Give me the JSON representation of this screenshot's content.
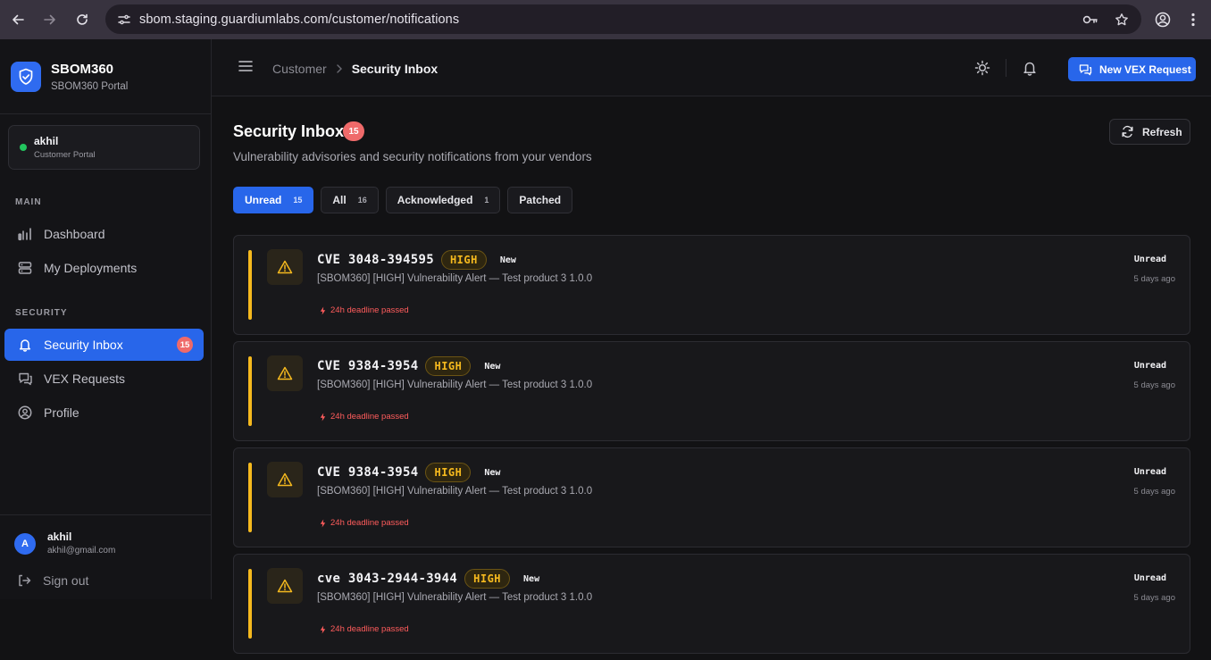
{
  "browser": {
    "url": "sbom.staging.guardiumlabs.com/customer/notifications"
  },
  "brand": {
    "name": "SBOM360",
    "subtitle": "SBOM360 Portal"
  },
  "user_card": {
    "name": "akhil",
    "role": "Customer Portal"
  },
  "sidebar": {
    "sections": [
      {
        "title": "MAIN"
      },
      {
        "title": "SECURITY"
      }
    ],
    "items": [
      {
        "label": "Dashboard",
        "icon": "bar-chart-icon"
      },
      {
        "label": "My Deployments",
        "icon": "server-icon"
      },
      {
        "label": "Security Inbox",
        "icon": "bell-icon",
        "badge": "15",
        "active": true
      },
      {
        "label": "VEX Requests",
        "icon": "chat-icon"
      },
      {
        "label": "Profile",
        "icon": "user-circle-icon"
      }
    ]
  },
  "footer": {
    "avatar_initial": "A",
    "name": "akhil",
    "email": "akhil@gmail.com",
    "signout": "Sign out"
  },
  "topbar": {
    "breadcrumb_parent": "Customer",
    "breadcrumb_current": "Security Inbox",
    "new_vex_label": "New VEX Request"
  },
  "page": {
    "title": "Security Inbox",
    "count": "15",
    "subtitle": "Vulnerability advisories and security notifications from your vendors",
    "refresh_label": "Refresh"
  },
  "tabs": [
    {
      "label": "Unread",
      "count": "15",
      "active": true
    },
    {
      "label": "All",
      "count": "16"
    },
    {
      "label": "Acknowledged",
      "count": "1"
    },
    {
      "label": "Patched",
      "count": ""
    }
  ],
  "notifications": [
    {
      "cve": "CVE 3048-394595",
      "severity": "HIGH",
      "tag": "New",
      "subject": "[SBOM360] [HIGH] Vulnerability Alert — Test product 3 1.0.0",
      "deadline": "24h deadline passed",
      "status": "Unread",
      "time": "5 days ago"
    },
    {
      "cve": "CVE 9384-3954",
      "severity": "HIGH",
      "tag": "New",
      "subject": "[SBOM360] [HIGH] Vulnerability Alert — Test product 3 1.0.0",
      "deadline": "24h deadline passed",
      "status": "Unread",
      "time": "5 days ago"
    },
    {
      "cve": "CVE 9384-3954",
      "severity": "HIGH",
      "tag": "New",
      "subject": "[SBOM360] [HIGH] Vulnerability Alert — Test product 3 1.0.0",
      "deadline": "24h deadline passed",
      "status": "Unread",
      "time": "5 days ago"
    },
    {
      "cve": "cve 3043-2944-3944",
      "severity": "HIGH",
      "tag": "New",
      "subject": "[SBOM360] [HIGH] Vulnerability Alert — Test product 3 1.0.0",
      "deadline": "24h deadline passed",
      "status": "Unread",
      "time": "5 days ago"
    }
  ],
  "colors": {
    "accent": "#2866ea",
    "high": "#f5b91e",
    "danger": "#ef6a6a"
  }
}
